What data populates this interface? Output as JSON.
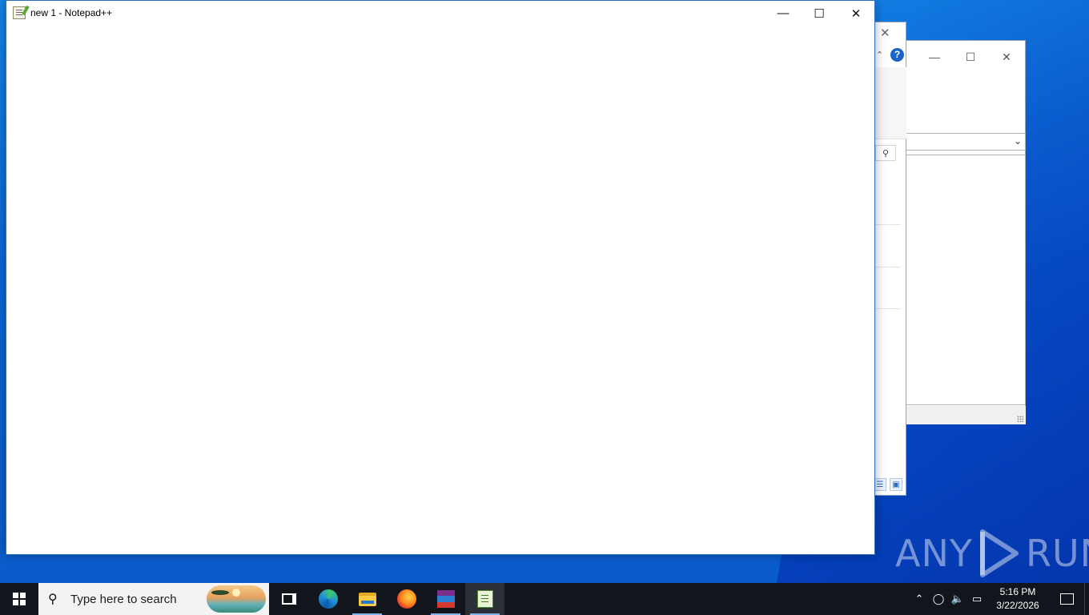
{
  "notepad": {
    "title": "new 1 - Notepad++",
    "icon": "notepad-plus-plus-icon"
  },
  "background_windows": {
    "help_label": "?"
  },
  "taskbar": {
    "search_placeholder": "Type here to search",
    "pinned": [
      {
        "name": "task-view",
        "icon": "task-view-icon"
      },
      {
        "name": "edge",
        "icon": "edge-icon"
      },
      {
        "name": "file-explorer",
        "icon": "folder-icon"
      },
      {
        "name": "firefox",
        "icon": "firefox-icon"
      },
      {
        "name": "winrar",
        "icon": "winrar-icon"
      },
      {
        "name": "notepad-plus-plus",
        "icon": "notepad-plus-plus-icon"
      }
    ],
    "clock": {
      "time": "5:16 PM",
      "date": "3/22/2026"
    }
  },
  "watermark": {
    "left": "ANY",
    "right": "RUN"
  },
  "colors": {
    "desktop": "#0b68d8",
    "taskbar": "#12151c",
    "window_border": "#2b6fbf"
  }
}
